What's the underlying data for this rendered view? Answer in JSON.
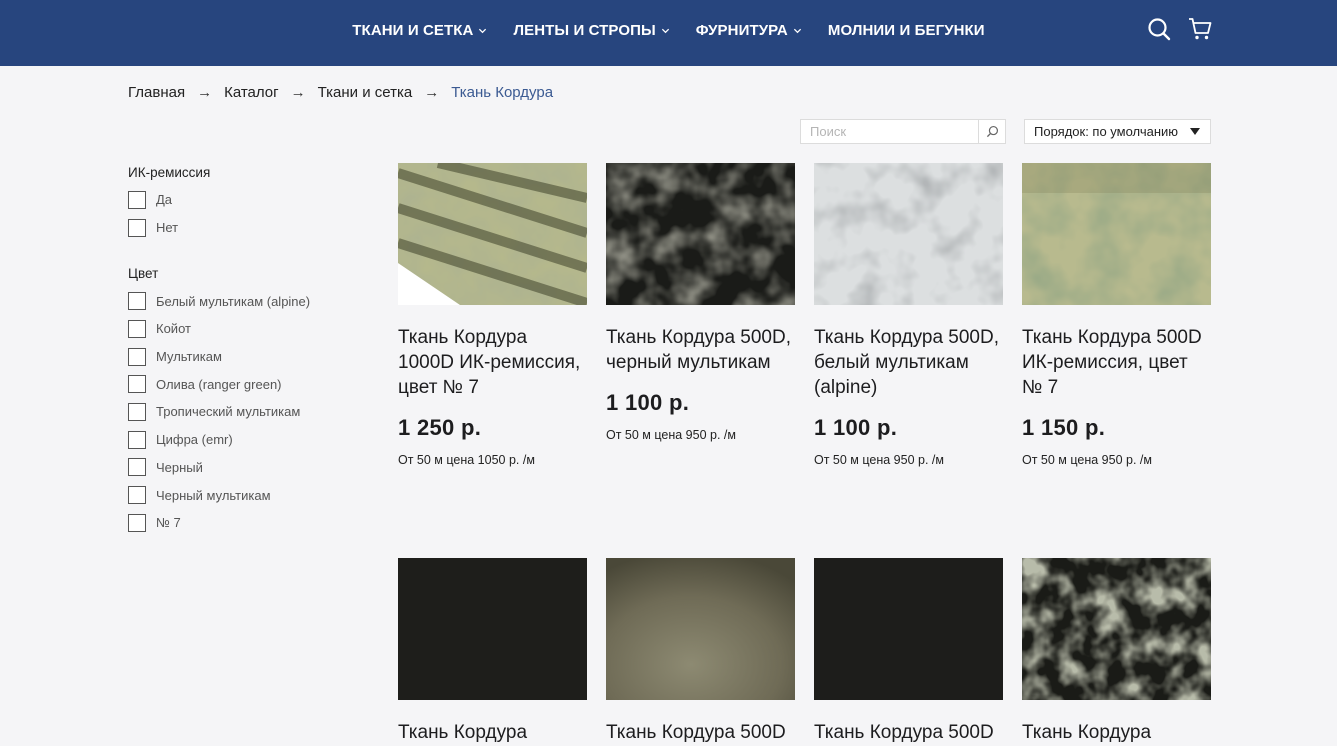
{
  "header": {
    "nav": [
      {
        "label": "ТКАНИ И СЕТКА",
        "dropdown": true
      },
      {
        "label": "ЛЕНТЫ И СТРОПЫ",
        "dropdown": true
      },
      {
        "label": "ФУРНИТУРА",
        "dropdown": true
      },
      {
        "label": "МОЛНИИ И БЕГУНКИ",
        "dropdown": false
      }
    ],
    "icons": [
      "search-icon",
      "cart-icon"
    ],
    "bg_color": "#27457e"
  },
  "breadcrumb": {
    "items": [
      "Главная",
      "Каталог",
      "Ткани и сетка"
    ],
    "separator": "→",
    "current": "Ткань Кордура"
  },
  "search": {
    "placeholder": "Поиск",
    "value": ""
  },
  "sort": {
    "label": "Порядок: по умолчанию"
  },
  "filters": [
    {
      "title": "ИК-ремиссия",
      "options": [
        "Да",
        "Нет"
      ]
    },
    {
      "title": "Цвет",
      "options": [
        "Белый мультикам (alpine)",
        "Койот",
        "Мультикам",
        "Олива (ranger green)",
        "Тропический мультикам",
        "Цифра (emr)",
        "Черный",
        "Черный мультикам",
        "№ 7"
      ]
    }
  ],
  "products": [
    {
      "title": "Ткань Кордура 1000D ИК-ремиссия, цвет № 7",
      "price": "1 250 р.",
      "note": "От 50 м цена 1050 р. /м",
      "image": "green-camo-folded"
    },
    {
      "title": "Ткань Кордура 500D, черный мультикам",
      "price": "1 100 р.",
      "note": "От 50 м цена 950 р. /м",
      "image": "black-multicam"
    },
    {
      "title": "Ткань Кордура 500D, белый мультикам (alpine)",
      "price": "1 100 р.",
      "note": "От 50 м цена 950 р. /м",
      "image": "white-multicam"
    },
    {
      "title": "Ткань Кордура 500D ИК-ремиссия, цвет № 7",
      "price": "1 150 р.",
      "note": "От 50 м цена 950 р. /м",
      "image": "green-camo-roll"
    },
    {
      "title": "Ткань Кордура",
      "price": "",
      "note": "",
      "image": "black-plain"
    },
    {
      "title": "Ткань Кордура 500D",
      "price": "",
      "note": "",
      "image": "olive-plain"
    },
    {
      "title": "Ткань Кордура 500D",
      "price": "",
      "note": "",
      "image": "black-plain-2"
    },
    {
      "title": "Ткань Кордура",
      "price": "",
      "note": "",
      "image": "black-multicam-2"
    }
  ]
}
